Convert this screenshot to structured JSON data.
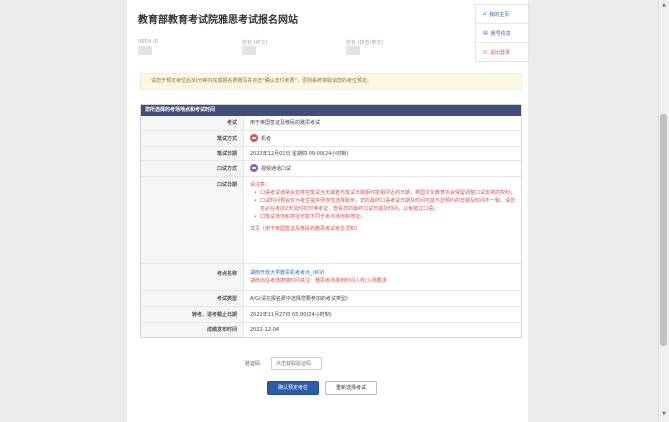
{
  "site": {
    "title": "教育部教育考试院雅思考试报名网站"
  },
  "user_info": {
    "neea_id_label": "NEEA ID",
    "name_cn_label": "姓名 (中文)",
    "name_en_label": "姓名 (拼音/英文)"
  },
  "nav": {
    "home": "我的主页",
    "account": "账号信息",
    "logout": "退出登录"
  },
  "notice": "请您于预定考位后30分钟内完成报名费缴写并点击\"确认支付考费\"，否则系统将取消您的考位预定。",
  "panel": {
    "title": "您所选择的考场地点和考试时间",
    "rows": {
      "exam": {
        "label": "考试",
        "value": "用于英国签证及移民的雅思考试"
      },
      "written_mode": {
        "label": "笔试方式",
        "value": "机考"
      },
      "written_date": {
        "label": "笔试日期",
        "value": "2022年12月01日 星期四 09:00(24小时制)"
      },
      "oral_mode": {
        "label": "口试方式",
        "value": "视频通话口试"
      },
      "oral_date": {
        "label": "口试日期",
        "intro": "请注意：",
        "items": [
          "口语考试通常会安排在笔试当天或者与笔试日期相可能相邻近的日期，英国文化教育协会保留调整口试安排的权利；",
          "口试时间预会仅为考生提供便寺性选择服务，您的最终口语考试日期及时间可能与您预约的日期及时间不一致。请您务必在考前2天及时打印准考证，查看您的最终口试日期及时间，以免错过口语；",
          "口笔试场地和地址可能不同于考点场地和地址；"
        ],
        "link": "详见《用于英国签证及移民的雅思考试考生须知》"
      },
      "venue": {
        "label": "考点名称",
        "value": "湖南开放大学雅思机考考点_UKVI",
        "note": "湖南出在考场按楼时间关注：雅思考场报到时间入校/入场要求"
      },
      "test_type": {
        "label": "考试类型",
        "value": "A/G(请在报名费中选择您要参加的考试类型)"
      },
      "deadline": {
        "label": "转考、退考截止日期",
        "value": "2022年11月27日 05:00(24小时制)"
      },
      "result_date": {
        "label": "成绩发布时间",
        "value": "2022-12-04"
      }
    }
  },
  "captcha": {
    "label": "验证码",
    "placeholder": "点击获取验证码"
  },
  "buttons": {
    "confirm": "确认预定考位",
    "reselect": "重新选择考试"
  },
  "colors": {
    "panel_header": "#434d79",
    "primary_button": "#2d5ca8",
    "notice_bg": "#fcf8e3",
    "warning_red": "#d9534f",
    "link_blue": "#2a6fc9"
  }
}
